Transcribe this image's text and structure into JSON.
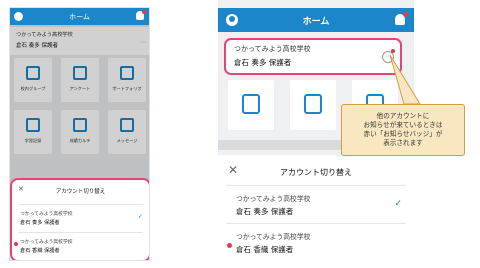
{
  "left_phone": {
    "header": {
      "title": "ホーム"
    },
    "account": {
      "school": "つかってみよう高校学校",
      "name": "倉石 奏多 保護者"
    },
    "tiles": [
      {
        "label": "校内グループ",
        "icon": "group-icon"
      },
      {
        "label": "アンケート",
        "icon": "survey-icon"
      },
      {
        "label": "ポートフォリオ",
        "icon": "portfolio-icon"
      },
      {
        "label": "学習記録",
        "icon": "chart-icon"
      },
      {
        "label": "成績カルテ",
        "icon": "report-icon"
      },
      {
        "label": "メッセージ",
        "icon": "message-icon"
      }
    ],
    "sheet": {
      "title": "アカウント切り替え",
      "rows": [
        {
          "school": "つかってみよう高校学校",
          "name": "倉石 奏多 保護者",
          "selected": true
        },
        {
          "school": "つかってみよう高校学校",
          "name": "倉石 香織 保護者",
          "has_badge": true
        }
      ]
    }
  },
  "right_phone": {
    "header": {
      "title": "ホーム"
    },
    "account": {
      "school": "つかってみよう高校学校",
      "name": "倉石 奏多 保護者"
    },
    "sheet": {
      "title": "アカウント切り替え",
      "rows": [
        {
          "school": "つかってみよう高校学校",
          "name": "倉石 奏多 保護者",
          "selected": true
        },
        {
          "school": "つかってみよう高校学校",
          "name": "倉石 香織 保護者",
          "has_badge": true
        }
      ]
    }
  },
  "callout": {
    "line1": "他のアカウントに",
    "line2": "お知らせが来ているときは",
    "line3": "赤い「お知らせバッジ」が",
    "line4": "表示されます"
  },
  "colors": {
    "primary": "#1b86c9",
    "highlight": "#e0457b",
    "badge": "#e53a4a",
    "callout_bg": "#f9e7c1"
  }
}
